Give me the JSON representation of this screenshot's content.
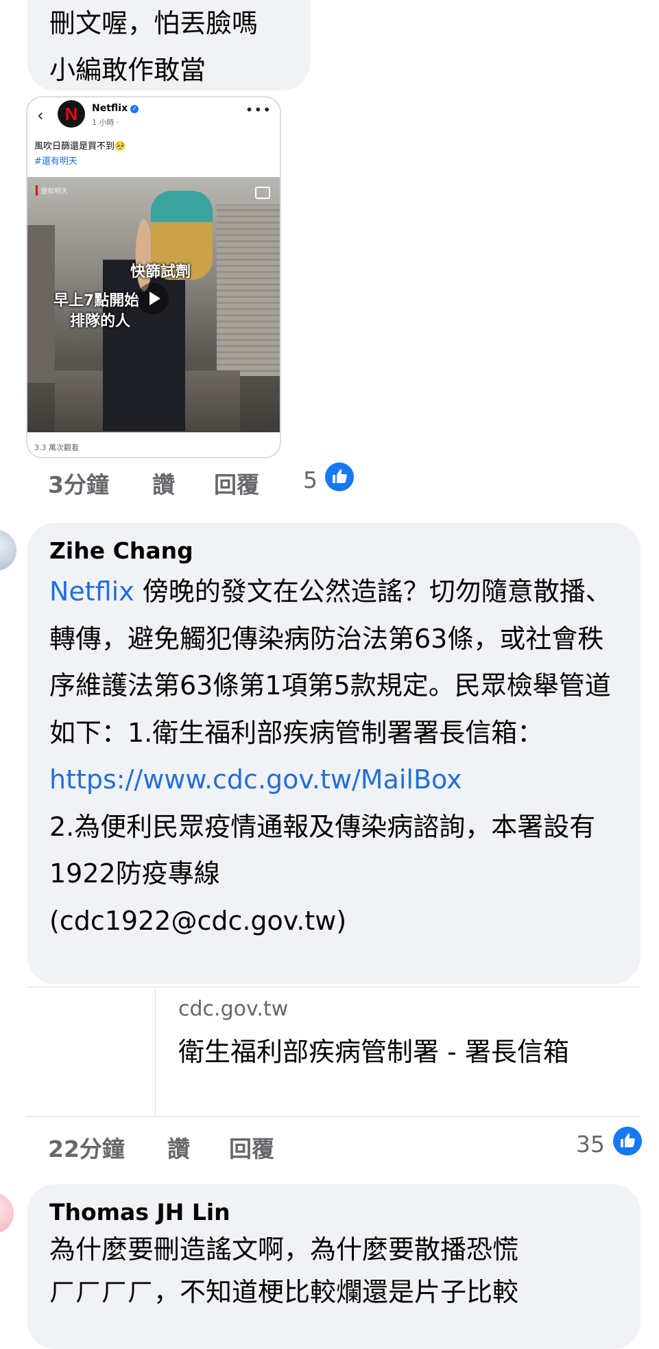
{
  "comment1": {
    "lines": [
      "刪文喔，怕丟臉嗎",
      "小編敢作敢當"
    ],
    "attachment": {
      "page_name": "Netflix",
      "post_time": "1 小時 ·",
      "caption": "風吹日篩還是買不到🥺",
      "hashtag": "#還有明天",
      "video_watermark": "還有明天",
      "overlay_text_1": "快篩試劑",
      "overlay_text_2": "早上7點開始",
      "overlay_text_3": "排隊的人",
      "views": "3.3 萬次觀看"
    },
    "time": "3分鐘",
    "like_label": "讚",
    "reply_label": "回覆",
    "reaction_count": "5"
  },
  "comment2": {
    "author": "Zihe  Chang",
    "mention": "Netflix",
    "text_1": " 傍晚的發文在公然造謠？切勿隨意散播、轉傳，避免觸犯傳染病防治法第63條，或社會秩序維護法第63條第1項第5款規定。民眾檢舉管道如下：1.衛生福利部疾病管制署署長信箱：",
    "url": "https://www.cdc.gov.tw/MailBox",
    "text_2": "2.為便利民眾疫情通報及傳染病諮詢，本署設有1922防疫專線",
    "text_3": "(cdc1922@cdc.gov.tw)",
    "preview_domain": "cdc.gov.tw",
    "preview_title": "衛生福利部疾病管制署 - 署長信箱",
    "time": "22分鐘",
    "like_label": "讚",
    "reply_label": "回覆",
    "reaction_count": "35"
  },
  "comment3": {
    "author": "Thomas JH Lin",
    "lines": [
      "為什麼要刪造謠文啊，為什麼要散播恐慌",
      "ㄏㄏㄏㄏ，不知道梗比較爛還是片子比較"
    ]
  },
  "colors": {
    "bubble": "#f0f2f5",
    "link": "#216fdb",
    "like_blue": "#1877f2",
    "meta_gray": "#65676b"
  }
}
